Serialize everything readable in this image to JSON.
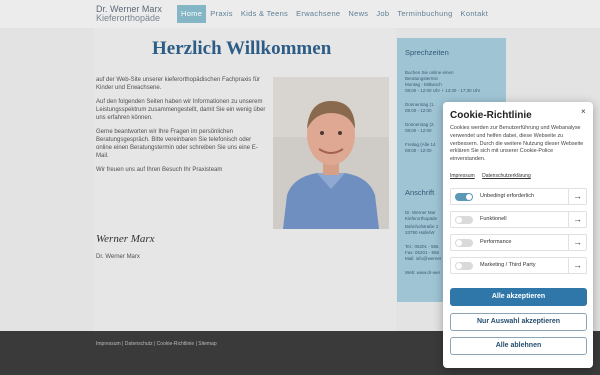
{
  "header": {
    "logo_line1": "Dr. Werner Marx",
    "logo_line2": "Kieferorthopäde",
    "nav": [
      "Home",
      "Praxis",
      "Kids & Teens",
      "Erwachsene",
      "News",
      "Job",
      "Terminbuchung",
      "Kontakt"
    ],
    "active_nav": "Home"
  },
  "main": {
    "title": "Herzlich Willkommen",
    "paragraphs": [
      "auf der Web-Site unserer kieferorthopädischen Fachpraxis für Kinder und Erwachsene.",
      "Auf den folgenden Seiten haben wir Informationen zu unserem Leistungsspektrum zusammengestellt, damit Sie ein wenig über uns erfahren können.",
      "Gerne beantworten wir Ihre Fragen im persönlichen Beratungsgespräch. Bitte vereinbaren Sie telefonisch oder online einen Beratungstermin oder schreiben Sie uns eine E-Mail.",
      "Wir freuen uns auf Ihren Besuch Ihr Praxisteam"
    ],
    "signature": "Werner Marx",
    "signature_name": "Dr. Werner Marx"
  },
  "sidebar": {
    "title": "Sprechzeiten",
    "lines": [
      "Buchen Sie online einen",
      "Beratungstermin",
      "Montag - Mittwoch",
      "08:00 - 12:00 Uhr + 13:30 - 17:30 Uhr",
      "",
      "Donnerstag (1.",
      "08:00 - 12:00",
      "",
      "Donnerstag (2.",
      "08:00 - 12:00",
      "",
      "Freitag (Alle 14",
      "08:00 - 12:00"
    ],
    "anschrift_title": "Anschrift",
    "anschrift_lines": [
      "Dr. Werner Mar",
      "Kieferorthopäde",
      "Bahnhofstraße 1",
      "33790 Halle/W",
      "",
      "Tel.: 05201 - 555",
      "Fax: 05201 - 555",
      "Mail: info@werner",
      "",
      "Web: www.dr-wer"
    ]
  },
  "footer": {
    "links": "Impressum | Datenschutz | Cookie-Richtlinie | Sitemap"
  },
  "cookie": {
    "title": "Cookie-Richtlinie",
    "close": "×",
    "text": "Cookies werden zur Benutzerführung und Webanalyse verwendet und helfen dabei, diese Webseite zu verbessern. Durch die weitere Nutzung dieser Webseite erklären Sie sich mit unserer Cookie-Police einverstanden.",
    "link_impressum": "Impressum",
    "link_datenschutz": "Datenschutzerklärung",
    "options": [
      {
        "label": "Unbedingt erforderlich",
        "on": true
      },
      {
        "label": "Funktionell",
        "on": false
      },
      {
        "label": "Performance",
        "on": false
      },
      {
        "label": "Marketing / Third Party",
        "on": false
      }
    ],
    "arrow": "→",
    "accept_all": "Alle akzeptieren",
    "accept_selection": "Nur Auswahl akzeptieren",
    "reject_all": "Alle ablehnen"
  },
  "colors": {
    "accent": "#85b6c6",
    "primary_button": "#2f77a8",
    "title_blue": "#2d5c86",
    "sidebar": "#9fc5d5"
  }
}
